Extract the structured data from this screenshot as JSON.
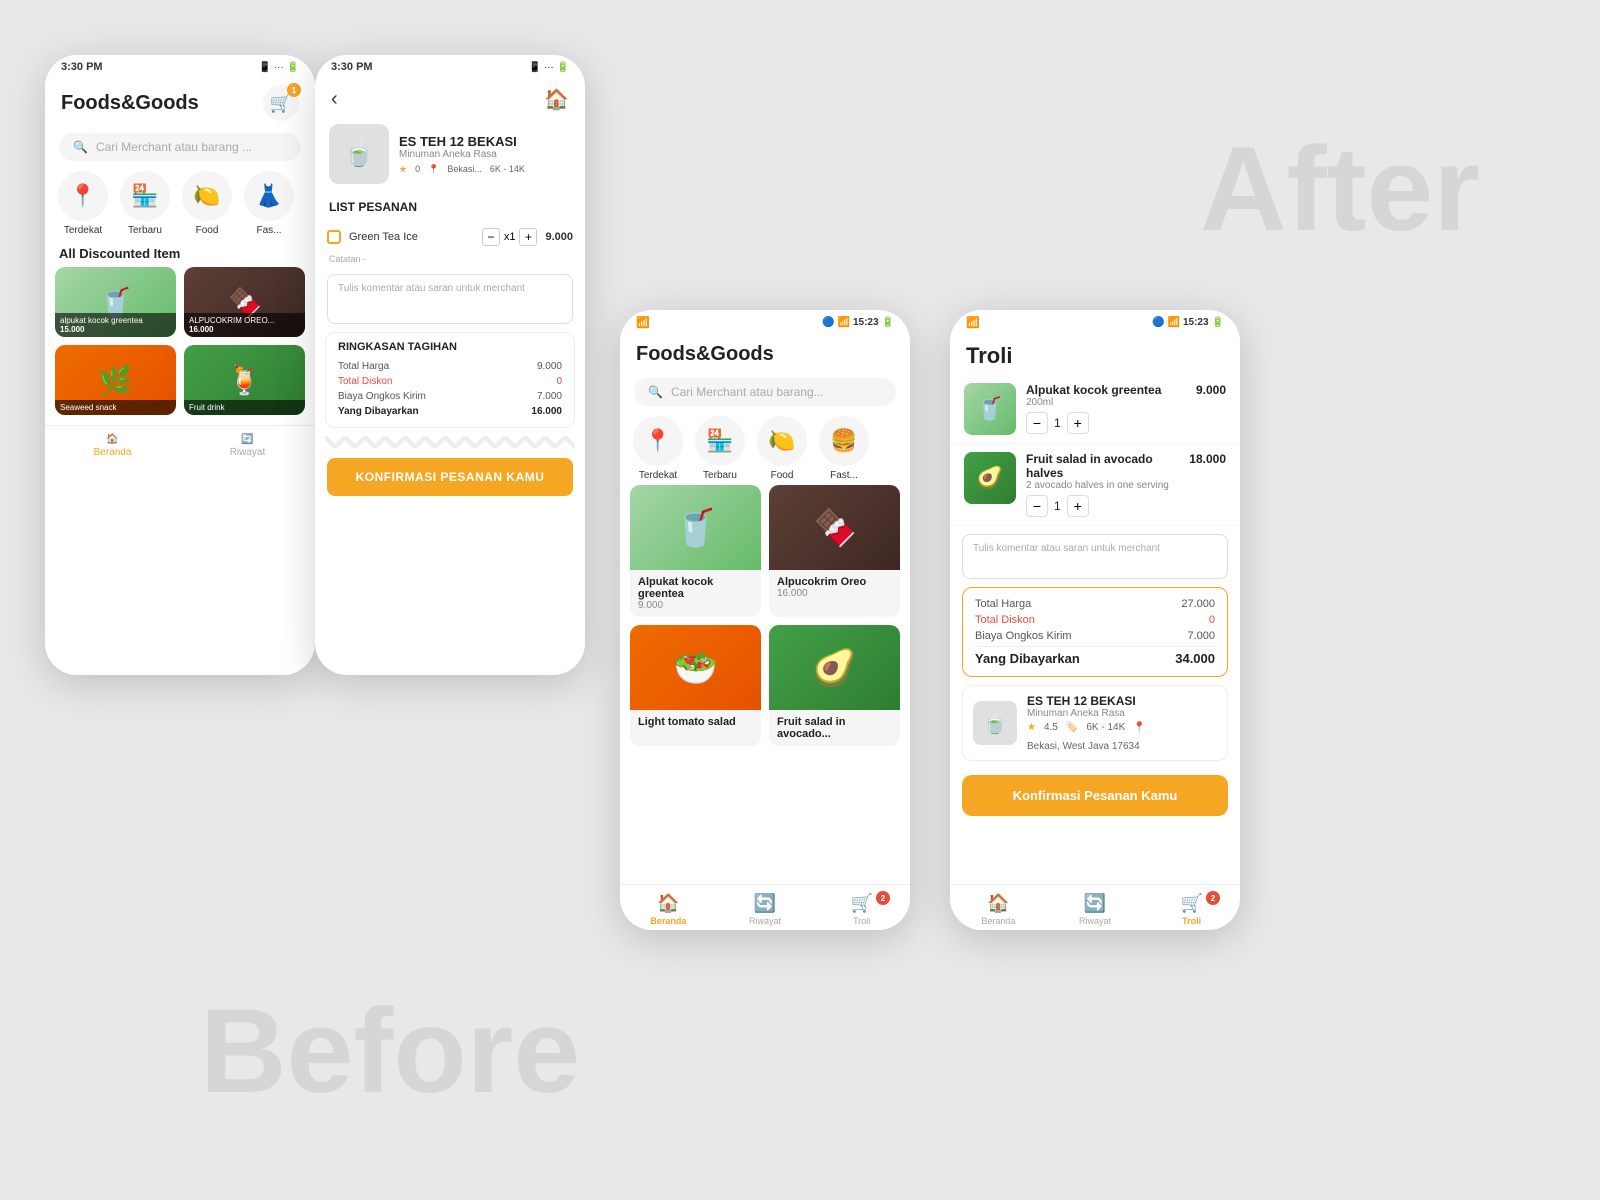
{
  "watermarks": {
    "before": "Before",
    "after": "After"
  },
  "phone1": {
    "status": {
      "time": "3:30 PM",
      "icons": "📱 ··· 🔋"
    },
    "header": {
      "title": "Foods&Goods",
      "cart_badge": "1"
    },
    "search": {
      "placeholder": "Cari Merchant atau barang ..."
    },
    "categories": [
      {
        "label": "Terdekat",
        "icon": "📍"
      },
      {
        "label": "Terbaru",
        "icon": "🏪"
      },
      {
        "label": "Food",
        "icon": "🍋"
      },
      {
        "label": "Fas...",
        "icon": "👗"
      }
    ],
    "section_title": "All Discounted Item",
    "foods": [
      {
        "name": "alpukat kocok greentea",
        "price": "15.000",
        "emoji": "🥤"
      },
      {
        "name": "ALPUCOKRIM OREO...",
        "price": "16.000",
        "emoji": "🧁"
      },
      {
        "name": "Seaweed snack",
        "price": "",
        "emoji": "🌿"
      },
      {
        "name": "Fruit drink",
        "price": "",
        "emoji": "🍹"
      }
    ],
    "nav": [
      {
        "label": "Beranda",
        "active": true,
        "icon": "🏠"
      },
      {
        "label": "Riwayat",
        "active": false,
        "icon": "🔄"
      }
    ]
  },
  "phone2": {
    "status": {
      "time": "3:30 PM"
    },
    "merchant": {
      "name": "ES TEH 12 BEKASI",
      "sub": "Minuman Aneka Rasa",
      "rating": "0",
      "location": "Bekasi...",
      "price_range": "6K - 14K",
      "emoji": "🍵"
    },
    "list_title": "LIST PESANAN",
    "items": [
      {
        "name": "Green Tea Ice",
        "qty": 1,
        "price": "9.000"
      }
    ],
    "note_label": "Catatan -",
    "comment_placeholder": "Tulis komentar atau saran untuk merchant",
    "ringkasan": {
      "title": "RINGKASAN TAGIHAN",
      "rows": [
        {
          "label": "Total Harga",
          "value": "9.000",
          "type": "normal"
        },
        {
          "label": "Total Diskon",
          "value": "0",
          "type": "diskon"
        },
        {
          "label": "Biaya Ongkos Kirim",
          "value": "7.000",
          "type": "normal"
        },
        {
          "label": "Yang Dibayarkan",
          "value": "16.000",
          "type": "total"
        }
      ]
    },
    "confirm_btn": "KONFIRMASI PESANAN KAMU"
  },
  "phone3": {
    "status": {
      "time": "15:23"
    },
    "header": {
      "title": "Foods&Goods"
    },
    "search": {
      "placeholder": "Cari Merchant atau barang..."
    },
    "categories": [
      {
        "label": "Terdekat",
        "icon": "📍"
      },
      {
        "label": "Terbaru",
        "icon": "🏪"
      },
      {
        "label": "Food",
        "icon": "🍋"
      },
      {
        "label": "Fast...",
        "icon": "🍔"
      }
    ],
    "foods": [
      {
        "name": "Alpukat kocok greentea",
        "price": "9.000",
        "emoji": "🥤",
        "bg": "tea"
      },
      {
        "name": "Alpucokrim Oreo",
        "price": "16.000",
        "emoji": "🍫",
        "bg": "oreo"
      },
      {
        "name": "Light tomato salad",
        "price": "",
        "emoji": "🥗",
        "bg": "salad"
      },
      {
        "name": "Fruit salad in avocado...",
        "price": "",
        "emoji": "🥑",
        "bg": "fruit"
      }
    ],
    "nav": [
      {
        "label": "Beranda",
        "active": true,
        "icon": "🏠"
      },
      {
        "label": "Riwayat",
        "active": false,
        "icon": "🔄"
      },
      {
        "label": "Troli",
        "active": false,
        "icon": "🛒",
        "badge": "2"
      }
    ]
  },
  "phone4": {
    "status": {
      "time": "15:23"
    },
    "header": {
      "title": "Troli"
    },
    "cart_items": [
      {
        "name": "Alpukat kocok greentea",
        "sub": "200ml",
        "price": "9.000",
        "qty": 1,
        "emoji": "🥤",
        "bg": "tea"
      },
      {
        "name": "Fruit salad in avocado halves",
        "sub": "2 avocado halves in one serving",
        "price": "18.000",
        "qty": 1,
        "emoji": "🥑",
        "bg": "fruit"
      }
    ],
    "comment_placeholder": "Tulis komentar atau saran untuk merchant",
    "summary": {
      "rows": [
        {
          "label": "Total Harga",
          "value": "27.000",
          "type": "normal"
        },
        {
          "label": "Total Diskon",
          "value": "0",
          "type": "diskon"
        },
        {
          "label": "Biaya Ongkos Kirim",
          "value": "7.000",
          "type": "normal"
        },
        {
          "label": "Yang Dibayarkan",
          "value": "34.000",
          "type": "total"
        }
      ]
    },
    "merchant": {
      "name": "ES TEH 12 BEKASI",
      "sub": "Minuman Aneka Rasa",
      "rating": "4.5",
      "price_range": "6K - 14K",
      "location": "Bekasi, West Java 17634",
      "emoji": "🍵"
    },
    "confirm_btn": "Konfirmasi Pesanan Kamu",
    "nav": [
      {
        "label": "Beranda",
        "active": false,
        "icon": "🏠"
      },
      {
        "label": "Riwayat",
        "active": false,
        "icon": "🔄"
      },
      {
        "label": "Troli",
        "active": true,
        "icon": "🛒",
        "badge": "2"
      }
    ]
  }
}
